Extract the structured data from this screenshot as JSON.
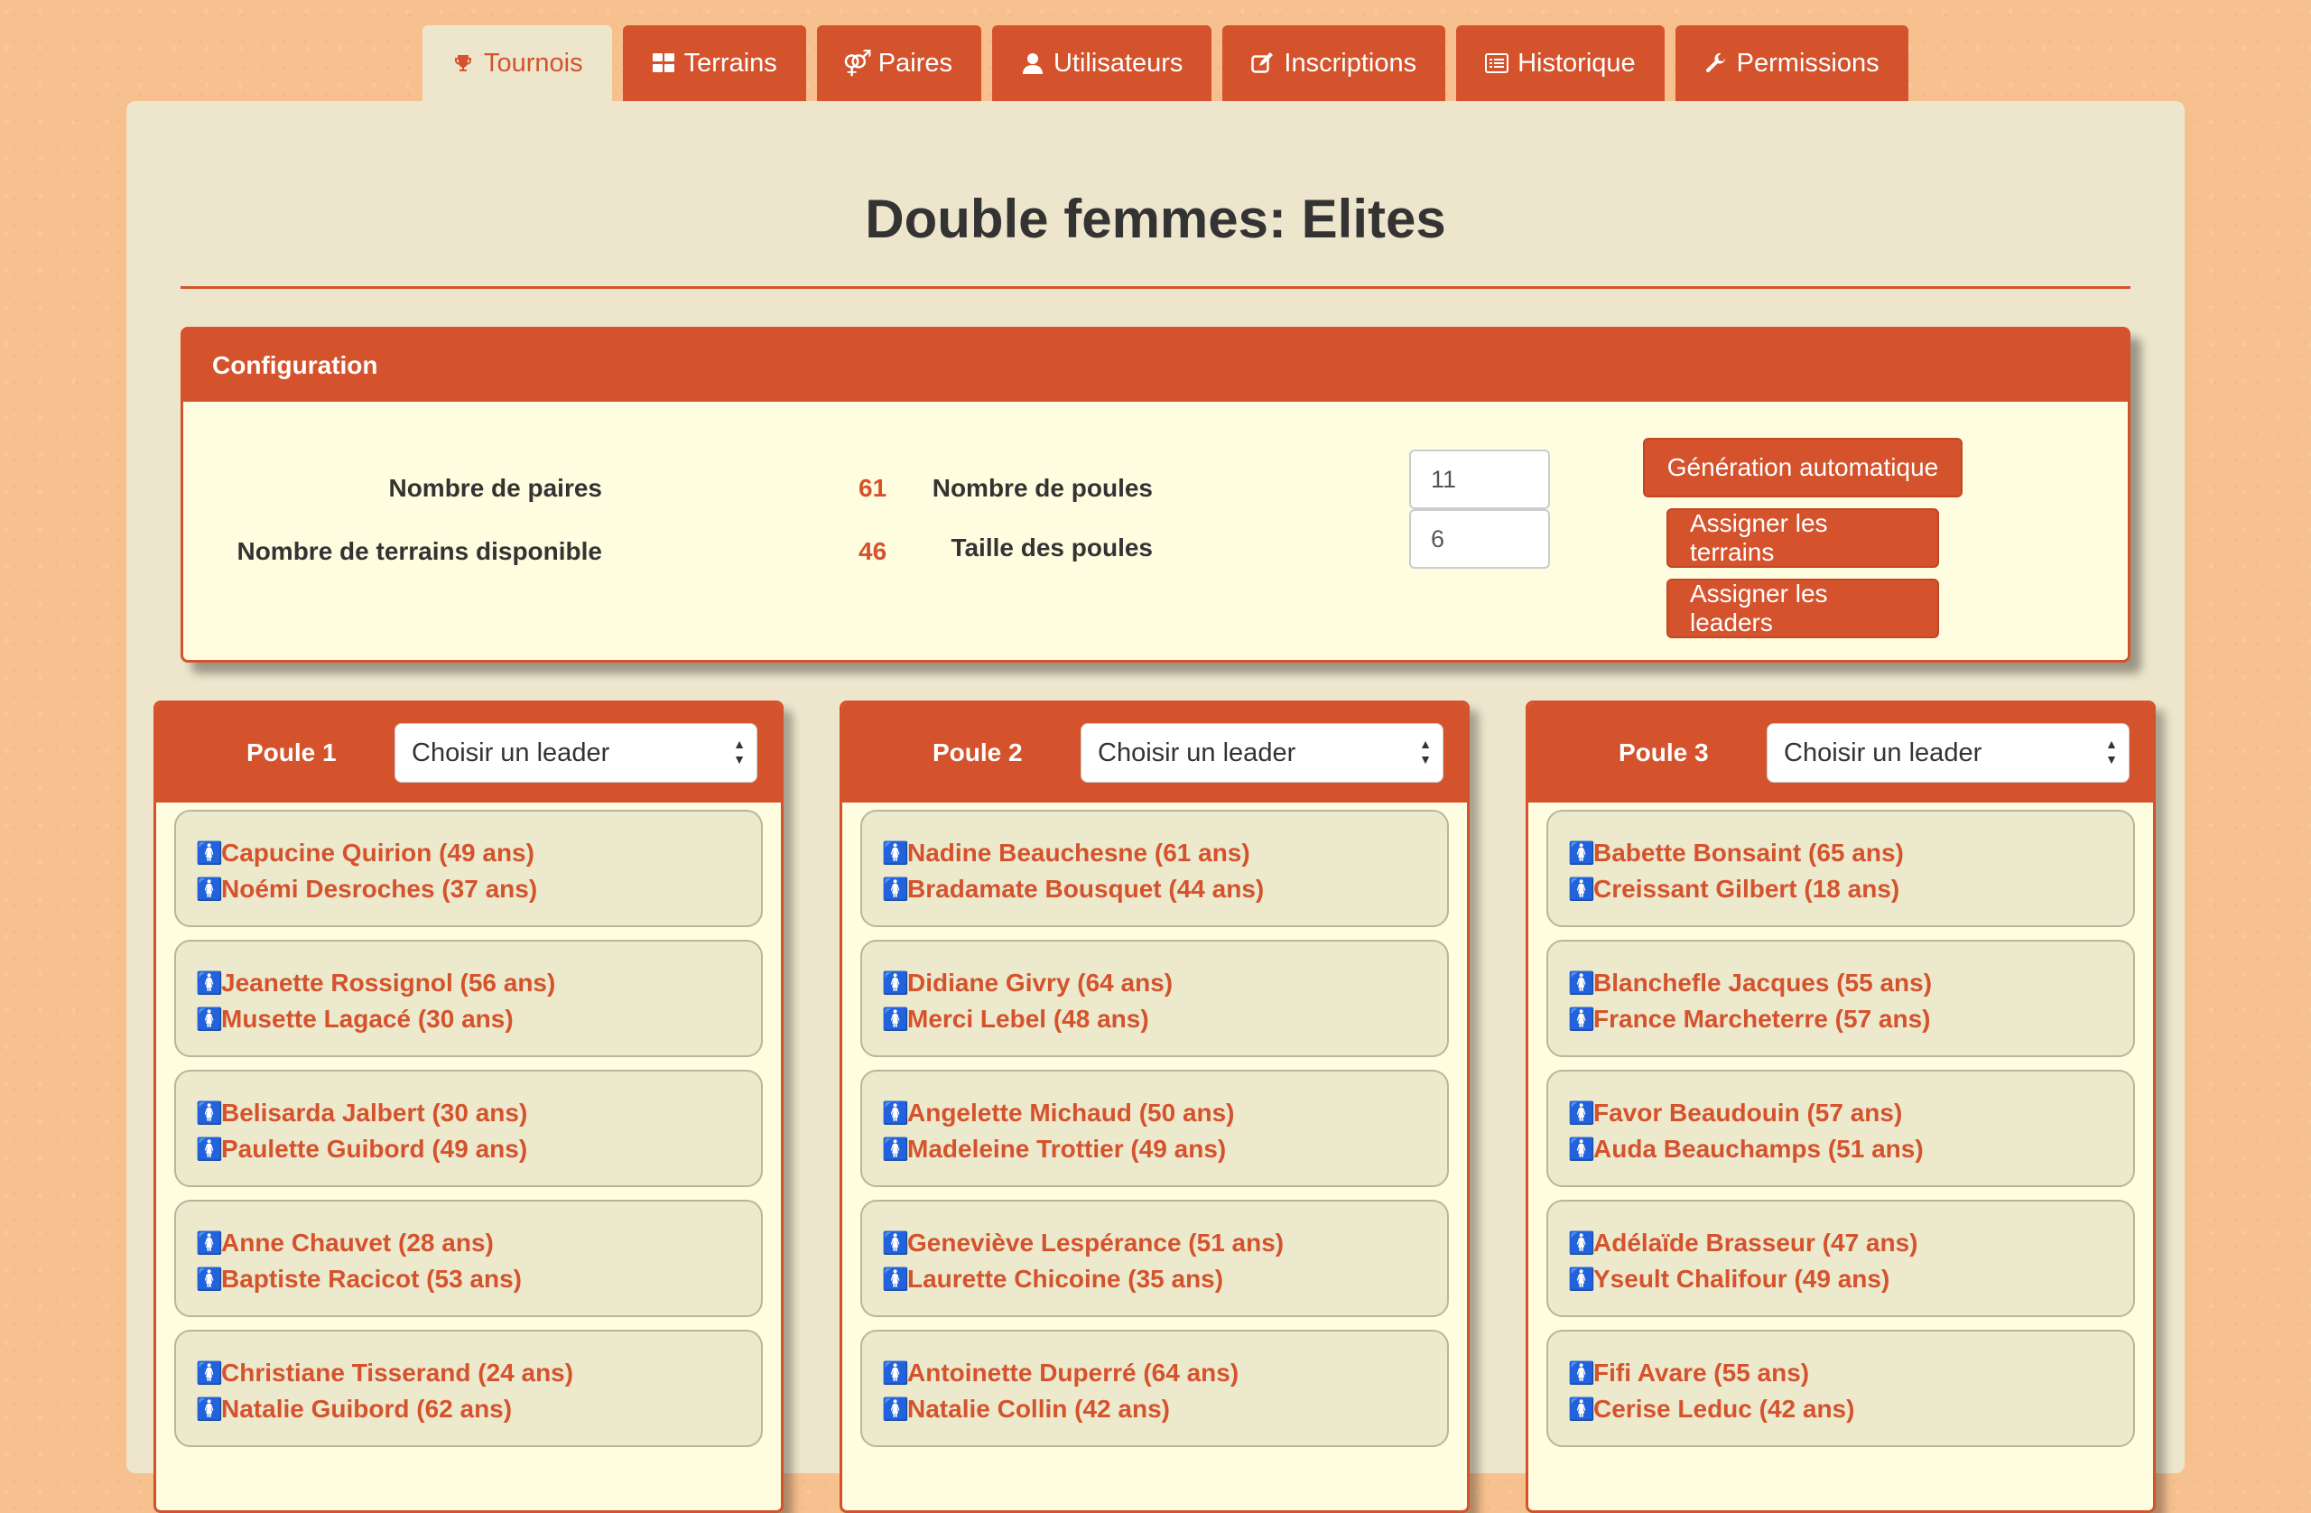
{
  "tabs": [
    {
      "label": "Tournois",
      "icon": "trophy-icon",
      "active": true
    },
    {
      "label": "Terrains",
      "icon": "grid-icon",
      "active": false
    },
    {
      "label": "Paires",
      "icon": "gender-icon",
      "active": false
    },
    {
      "label": "Utilisateurs",
      "icon": "user-icon",
      "active": false
    },
    {
      "label": "Inscriptions",
      "icon": "edit-icon",
      "active": false
    },
    {
      "label": "Historique",
      "icon": "list-icon",
      "active": false
    },
    {
      "label": "Permissions",
      "icon": "wrench-icon",
      "active": false
    }
  ],
  "page_title": "Double femmes: Elites",
  "config": {
    "header": "Configuration",
    "pairs_label": "Nombre de paires",
    "pairs_value": "61",
    "courts_label": "Nombre de terrains disponible",
    "courts_value": "46",
    "pools_label": "Nombre de poules",
    "pools_value": "11",
    "pool_size_label": "Taille des poules",
    "pool_size_value": "6",
    "btn_auto": "Génération automatique",
    "btn_courts": "Assigner les terrains",
    "btn_leaders": "Assigner les leaders"
  },
  "accent_color": "#d4532d",
  "player_icon_color": "#e0156b",
  "poules": [
    {
      "name": "Poule 1",
      "leader_select": "Choisir un leader",
      "pairs": [
        [
          "Capucine Quirion (49 ans)",
          "Noémi Desroches (37 ans)"
        ],
        [
          "Jeanette Rossignol (56 ans)",
          "Musette Lagacé (30 ans)"
        ],
        [
          "Belisarda Jalbert (30 ans)",
          "Paulette Guibord (49 ans)"
        ],
        [
          "Anne Chauvet (28 ans)",
          "Baptiste Racicot (53 ans)"
        ],
        [
          "Christiane Tisserand (24 ans)",
          "Natalie Guibord (62 ans)"
        ]
      ]
    },
    {
      "name": "Poule 2",
      "leader_select": "Choisir un leader",
      "pairs": [
        [
          "Nadine Beauchesne (61 ans)",
          "Bradamate Bousquet (44 ans)"
        ],
        [
          "Didiane Givry (64 ans)",
          "Merci Lebel (48 ans)"
        ],
        [
          "Angelette Michaud (50 ans)",
          "Madeleine Trottier (49 ans)"
        ],
        [
          "Geneviève Lespérance (51 ans)",
          "Laurette Chicoine (35 ans)"
        ],
        [
          "Antoinette Duperré (64 ans)",
          "Natalie Collin (42 ans)"
        ]
      ]
    },
    {
      "name": "Poule 3",
      "leader_select": "Choisir un leader",
      "pairs": [
        [
          "Babette Bonsaint (65 ans)",
          "Creissant Gilbert (18 ans)"
        ],
        [
          "Blanchefle Jacques (55 ans)",
          "France Marcheterre (57 ans)"
        ],
        [
          "Favor Beaudouin (57 ans)",
          "Auda Beauchamps (51 ans)"
        ],
        [
          "Adélaïde Brasseur (47 ans)",
          "Yseult Chalifour (49 ans)"
        ],
        [
          "Fifi Avare (55 ans)",
          "Cerise Leduc (42 ans)"
        ]
      ]
    }
  ]
}
